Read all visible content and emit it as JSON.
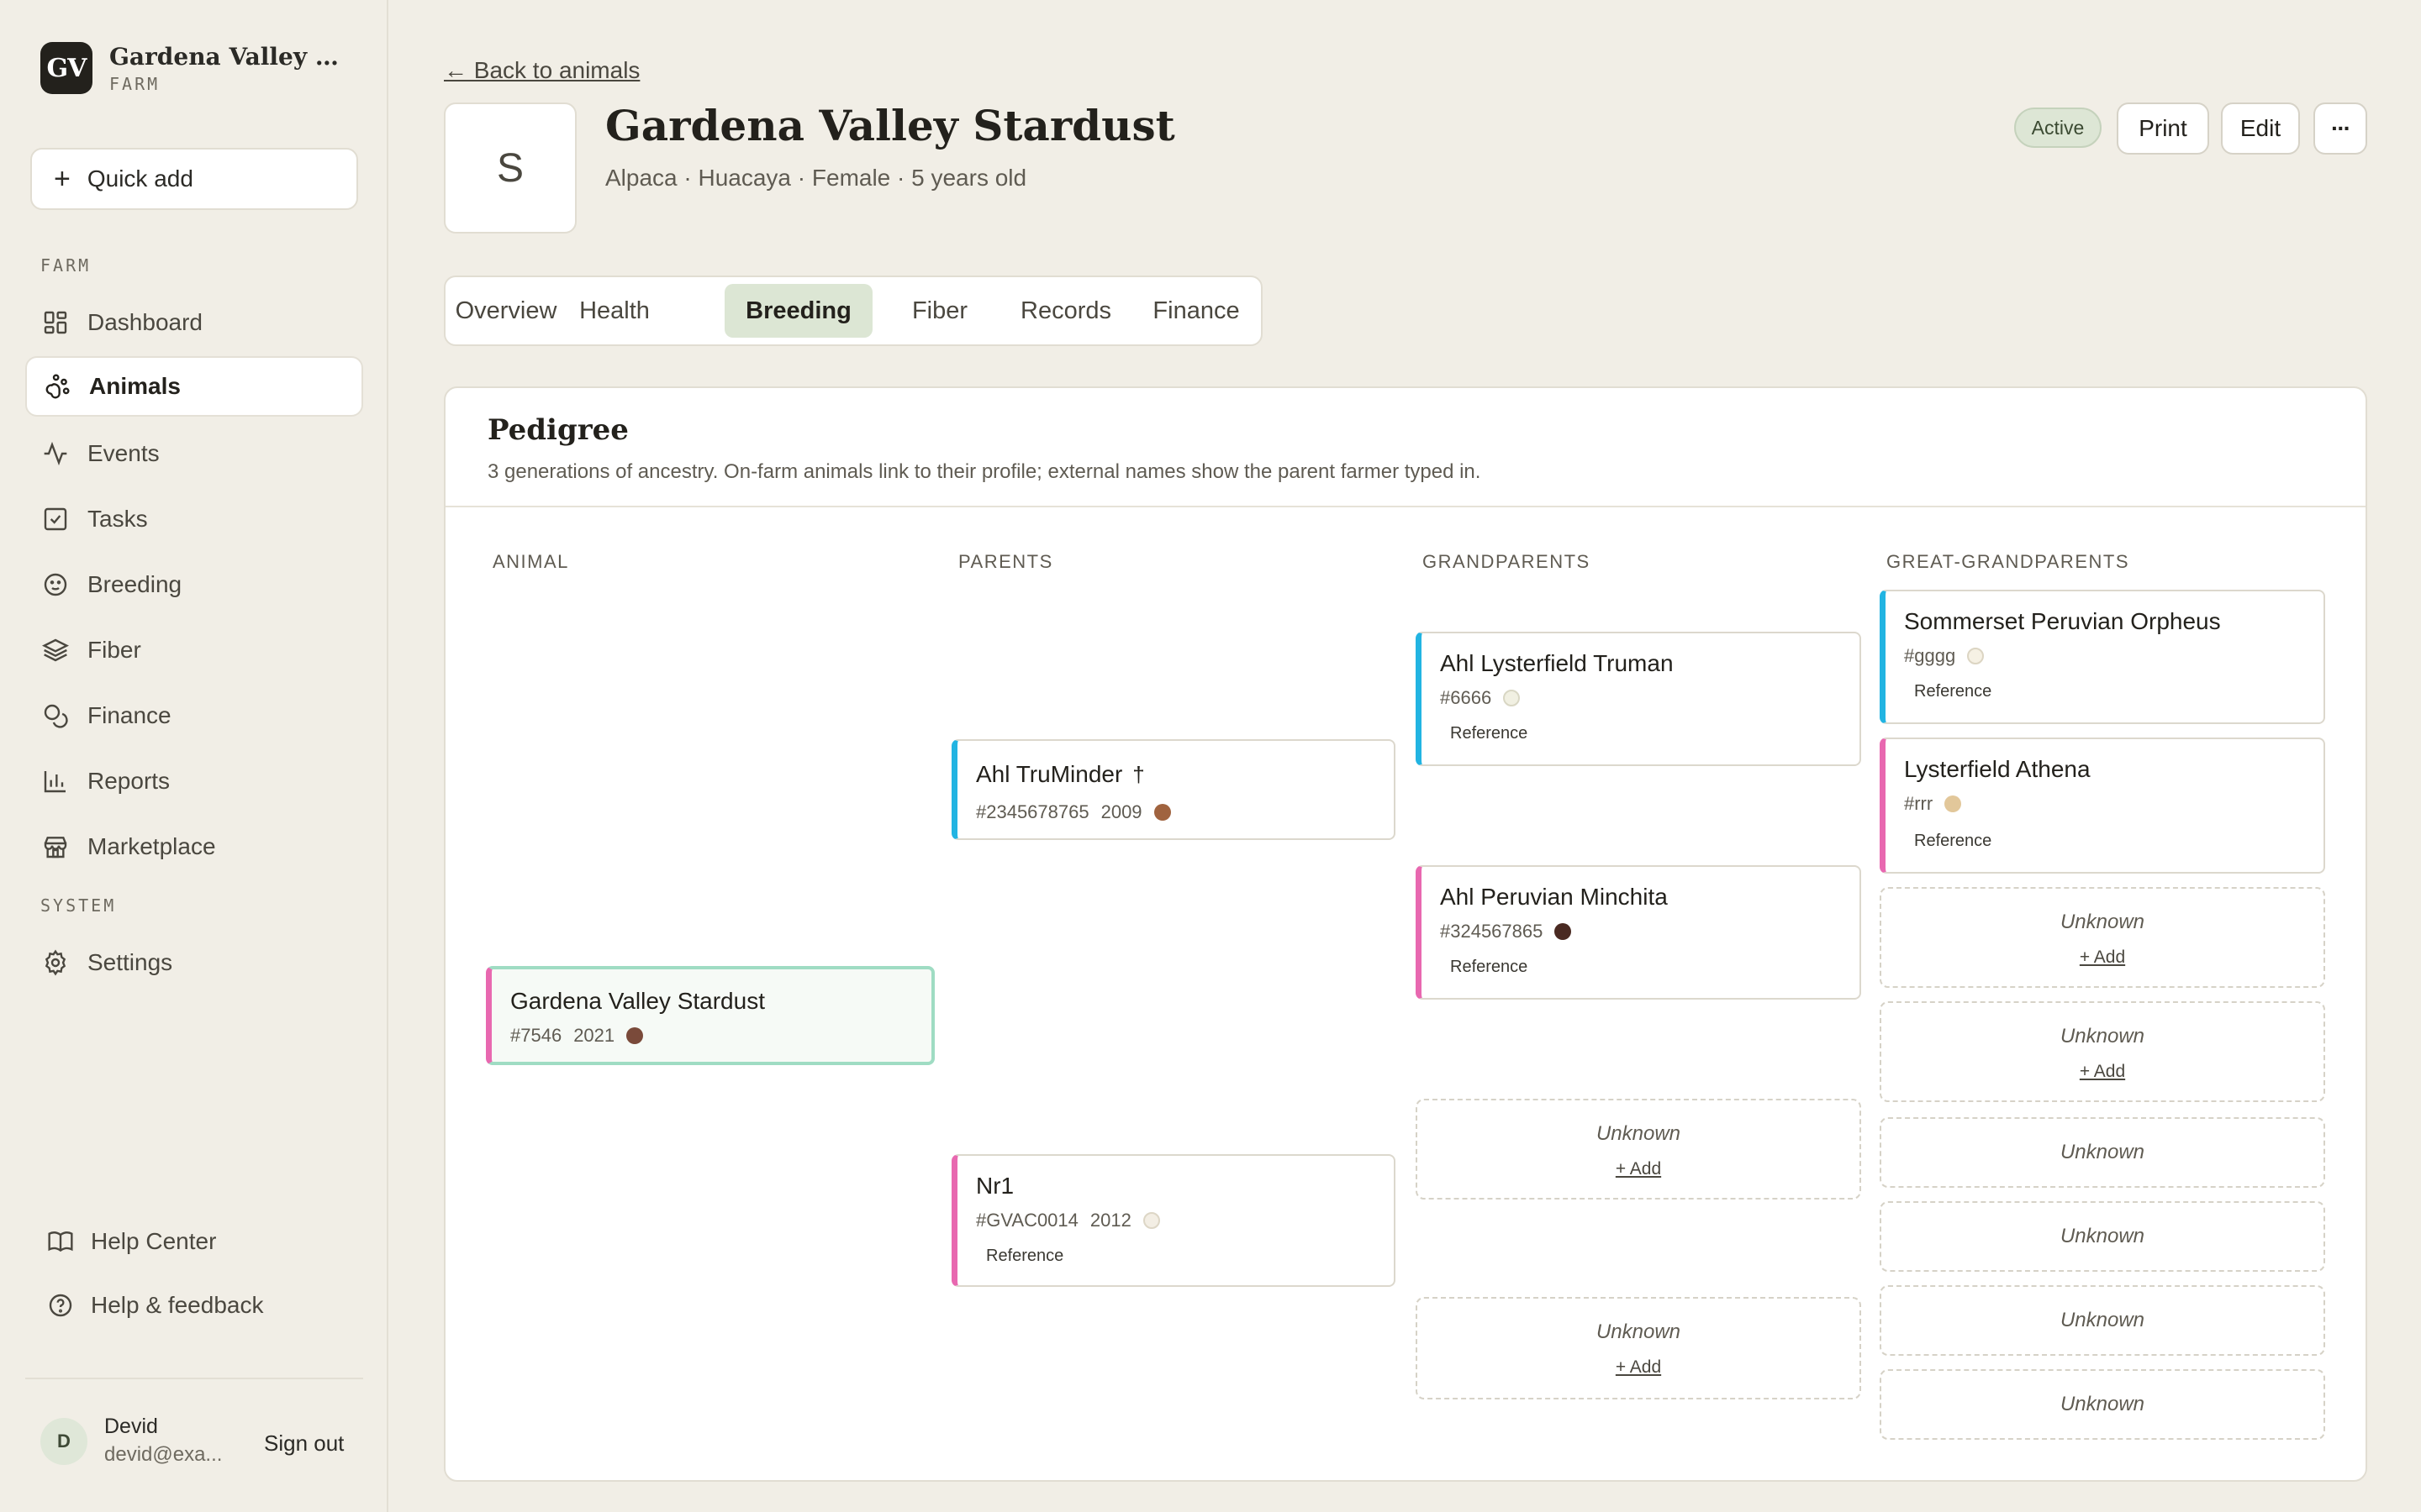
{
  "sidebar": {
    "brand_initials": "GV",
    "farm_name": "Gardena Valley Alp...",
    "farm_label": "FARM",
    "quick_add": "Quick add",
    "section_farm": "FARM",
    "section_system": "SYSTEM",
    "nav": {
      "dashboard": "Dashboard",
      "animals": "Animals",
      "events": "Events",
      "tasks": "Tasks",
      "breeding": "Breeding",
      "fiber": "Fiber",
      "finance": "Finance",
      "reports": "Reports",
      "marketplace": "Marketplace",
      "settings": "Settings"
    },
    "help_center": "Help Center",
    "help_feedback": "Help & feedback",
    "user": {
      "initial": "D",
      "name": "Devid",
      "email": "devid@exa...",
      "sign_out": "Sign out"
    }
  },
  "header": {
    "back": "← Back to animals",
    "avatar_letter": "S",
    "title": "Gardena Valley Stardust",
    "subtitle": "Alpaca · Huacaya · Female · 5 years old",
    "status": "Active",
    "print": "Print",
    "edit": "Edit",
    "more": "···"
  },
  "tabs": {
    "overview": "Overview",
    "health": "Health",
    "breeding": "Breeding",
    "fiber": "Fiber",
    "records": "Records",
    "finance": "Finance",
    "active": "Breeding"
  },
  "pedigree": {
    "title": "Pedigree",
    "description": "3 generations of ancestry. On-farm animals link to their profile; external names show the parent farmer typed in.",
    "columns": {
      "animal": "ANIMAL",
      "parents": "PARENTS",
      "grandparents": "GRANDPARENTS",
      "great_grandparents": "GREAT-GRANDPARENTS"
    },
    "reference_label": "Reference",
    "unknown_label": "Unknown",
    "add_label": "+ Add",
    "animal": {
      "name": "Gardena Valley Stardust",
      "id": "#7546",
      "year": "2021",
      "color": "#7a4a3a"
    },
    "sire": {
      "name": "Ahl TruMinder",
      "deceased_mark": "†",
      "id": "#2345678765",
      "year": "2009",
      "color": "#a0633f"
    },
    "dam": {
      "name": "Nr1",
      "id": "#GVAC0014",
      "year": "2012",
      "color": "#f3eee4"
    },
    "sire_sire": {
      "name": "Ahl Lysterfield Truman",
      "id": "#6666",
      "color": "#f1f0e2"
    },
    "sire_dam": {
      "name": "Ahl Peruvian Minchita",
      "id": "#324567865",
      "color": "#4a2a22"
    },
    "ggp1": {
      "name": "Sommerset Peruvian Orpheus",
      "id": "#gggg",
      "color": "#f6f1e4"
    },
    "ggp2": {
      "name": "Lysterfield Athena",
      "id": "#rrr",
      "color": "#e2c79a"
    }
  }
}
